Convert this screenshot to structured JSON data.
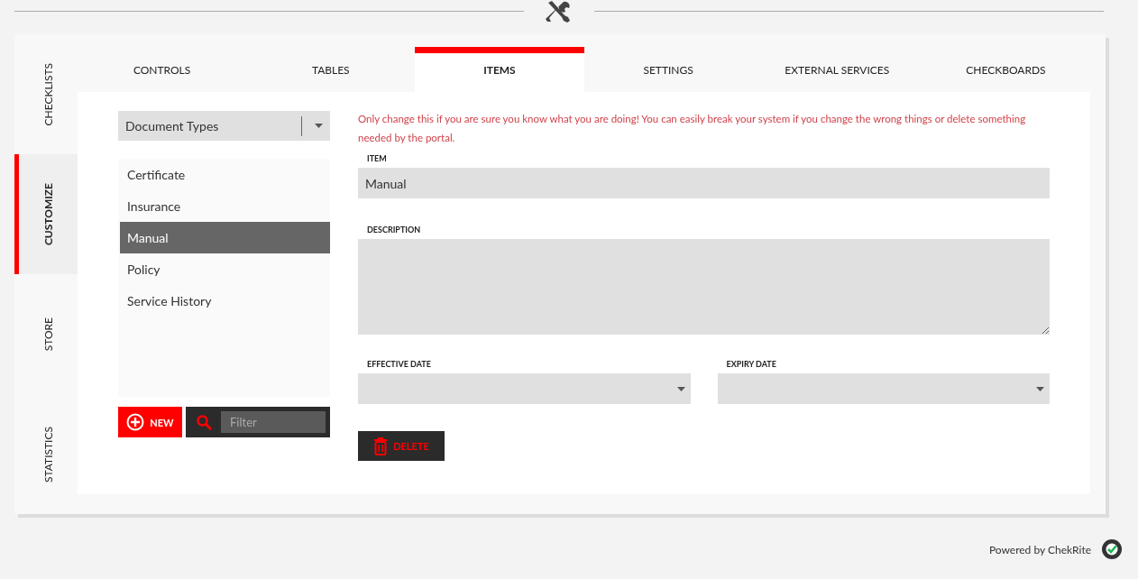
{
  "side_tabs": [
    {
      "label": "CHECKLISTS",
      "selected": false
    },
    {
      "label": "CUSTOMIZE",
      "selected": true
    },
    {
      "label": "STORE",
      "selected": false
    },
    {
      "label": "STATISTICS",
      "selected": false
    }
  ],
  "tabs": [
    {
      "label": "CONTROLS",
      "selected": false
    },
    {
      "label": "TABLES",
      "selected": false
    },
    {
      "label": "ITEMS",
      "selected": true
    },
    {
      "label": "SETTINGS",
      "selected": false
    },
    {
      "label": "EXTERNAL SERVICES",
      "selected": false
    },
    {
      "label": "CHECKBOARDS",
      "selected": false
    }
  ],
  "type_select": {
    "value": "Document Types"
  },
  "items": [
    {
      "label": "Certificate",
      "selected": false
    },
    {
      "label": "Insurance",
      "selected": false
    },
    {
      "label": "Manual",
      "selected": true
    },
    {
      "label": "Policy",
      "selected": false
    },
    {
      "label": "Service History",
      "selected": false
    }
  ],
  "new_button": "NEW",
  "filter": {
    "placeholder": "Filter"
  },
  "warning": "Only change this if you are sure you know what you are doing! You can easily break your system if you change the wrong things or delete something needed by the portal.",
  "item_field": {
    "label": "ITEM",
    "value": "Manual"
  },
  "description_field": {
    "label": "DESCRIPTION"
  },
  "effective_date": {
    "label": "EFFECTIVE DATE"
  },
  "expiry_date": {
    "label": "EXPIRY DATE"
  },
  "delete_button": "DELETE",
  "footer": "Powered by ChekRite"
}
